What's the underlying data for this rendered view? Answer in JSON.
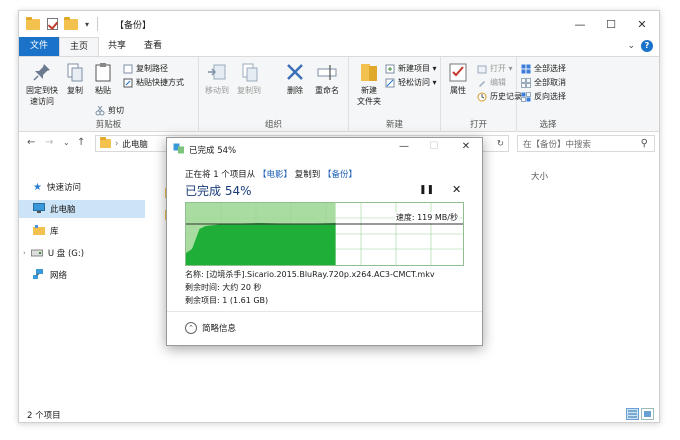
{
  "window": {
    "title": "【备份】",
    "controls": {
      "minimize": "—",
      "maximize": "☐",
      "close": "✕"
    }
  },
  "ribbon_tabs": [
    {
      "label": "文件"
    },
    {
      "label": "主页"
    },
    {
      "label": "共享"
    },
    {
      "label": "查看"
    }
  ],
  "ribbon": {
    "clipboard": {
      "label": "剪贴板",
      "pin": "固定到快\n速访问",
      "copy": "复制",
      "paste": "粘贴",
      "copy_path": "复制路径",
      "paste_shortcut": "粘贴快捷方式",
      "cut": "剪切"
    },
    "organize": {
      "label": "组织",
      "move_to": "移动到",
      "copy_to": "复制到",
      "delete": "删除",
      "rename": "重命名"
    },
    "new": {
      "label": "新建",
      "new_folder": "新建\n文件夹",
      "new_item": "新建项目 ▾",
      "easy_access": "轻松访问 ▾"
    },
    "open": {
      "label": "打开",
      "properties": "属性",
      "open": "打开 ▾",
      "edit": "编辑",
      "history": "历史记录"
    },
    "select": {
      "label": "选择",
      "select_all": "全部选择",
      "select_none": "全部取消",
      "invert": "反向选择"
    }
  },
  "address": {
    "back": "←",
    "forward": "→",
    "recent": "⌄",
    "up": "↑",
    "path": "此电脑",
    "sep": "›",
    "refresh": "↻",
    "search_placeholder": "在【备份】中搜索",
    "search_icon": "⚲"
  },
  "nav_pane": {
    "items": [
      {
        "label": "快速访问",
        "icon": "star-icon"
      },
      {
        "label": "此电脑",
        "icon": "computer-icon"
      },
      {
        "label": "库",
        "icon": "library-icon"
      },
      {
        "label": "U 盘 (G:)",
        "icon": "usb-drive-icon"
      },
      {
        "label": "网络",
        "icon": "network-icon"
      }
    ]
  },
  "content": {
    "size_column": "大小"
  },
  "status": {
    "item_count": "2 个项目"
  },
  "dialog": {
    "title": "已完成 54%",
    "controls": {
      "minimize": "—",
      "maximize": "☐",
      "close": "✕"
    },
    "copying_prefix": "正在将 1 个项目从",
    "source": "【电影】",
    "to_text": "复制到",
    "dest": "【备份】",
    "heading": "已完成 54%",
    "pause": "❚❚",
    "cancel": "✕",
    "speed": "速度: 119 MB/秒",
    "progress_percent": 54,
    "name_label": "名称:",
    "name_value": "[边境杀手].Sicario.2015.BluRay.720p.x264.AC3-CMCT.mkv",
    "time_label": "剩余时间:",
    "time_value": "大约 20 秒",
    "items_label": "剩余项目:",
    "items_value": "1 (1.61 GB)",
    "details_arrow": "⌃",
    "details": "简略信息"
  },
  "colors": {
    "accent": "#1a73c8",
    "progress_fill": "#a8dca0",
    "graph_fill": "#1fae37"
  }
}
